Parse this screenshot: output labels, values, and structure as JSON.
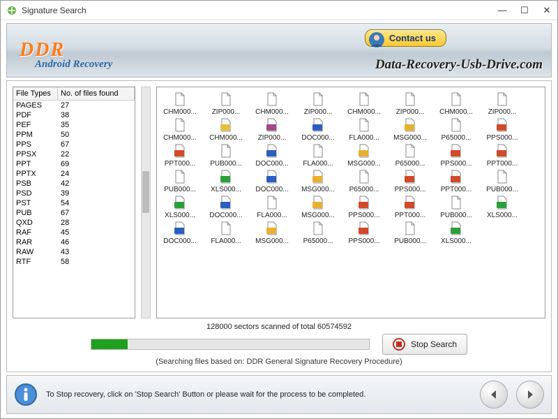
{
  "window": {
    "title": "Signature Search"
  },
  "header": {
    "brand": "DDR",
    "subtitle": "Android Recovery",
    "contact_label": "Contact us",
    "watermark": "Data-Recovery-Usb-Drive.com"
  },
  "fileTypesTable": {
    "col1": "File Types",
    "col2": "No. of files found",
    "rows": [
      {
        "type": "PAGES",
        "count": 27
      },
      {
        "type": "PDF",
        "count": 38
      },
      {
        "type": "PEF",
        "count": 35
      },
      {
        "type": "PPM",
        "count": 50
      },
      {
        "type": "PPS",
        "count": 67
      },
      {
        "type": "PPSX",
        "count": 22
      },
      {
        "type": "PPT",
        "count": 69
      },
      {
        "type": "PPTX",
        "count": 24
      },
      {
        "type": "PSB",
        "count": 42
      },
      {
        "type": "PSD",
        "count": 39
      },
      {
        "type": "PST",
        "count": 54
      },
      {
        "type": "PUB",
        "count": 67
      },
      {
        "type": "QXD",
        "count": 28
      },
      {
        "type": "RAF",
        "count": 45
      },
      {
        "type": "RAR",
        "count": 46
      },
      {
        "type": "RAW",
        "count": 43
      },
      {
        "type": "RTF",
        "count": 58
      }
    ]
  },
  "files": [
    {
      "name": "CHM000...",
      "icon": "file"
    },
    {
      "name": "ZIP000...",
      "icon": "file"
    },
    {
      "name": "CHM000...",
      "icon": "file"
    },
    {
      "name": "ZIP000...",
      "icon": "file"
    },
    {
      "name": "CHM000...",
      "icon": "file"
    },
    {
      "name": "ZIP000...",
      "icon": "file"
    },
    {
      "name": "CHM000...",
      "icon": "file"
    },
    {
      "name": "ZIP000...",
      "icon": "file"
    },
    {
      "name": "CHM000...",
      "icon": "file"
    },
    {
      "name": "CHM000...",
      "icon": "chm"
    },
    {
      "name": "ZIP000...",
      "icon": "zip"
    },
    {
      "name": "DOC000...",
      "icon": "doc"
    },
    {
      "name": "FLA000...",
      "icon": "file"
    },
    {
      "name": "MSG000...",
      "icon": "msg"
    },
    {
      "name": "P65000...",
      "icon": "file"
    },
    {
      "name": "PPS000...",
      "icon": "pps"
    },
    {
      "name": "PPT000...",
      "icon": "ppt"
    },
    {
      "name": "PUB000...",
      "icon": "file"
    },
    {
      "name": "DOC000...",
      "icon": "doc"
    },
    {
      "name": "FLA000...",
      "icon": "file"
    },
    {
      "name": "MSG000...",
      "icon": "msg"
    },
    {
      "name": "P65000...",
      "icon": "file"
    },
    {
      "name": "PPS000...",
      "icon": "pps"
    },
    {
      "name": "PPT000...",
      "icon": "ppt"
    },
    {
      "name": "PUB000...",
      "icon": "file"
    },
    {
      "name": "XLS000...",
      "icon": "xls"
    },
    {
      "name": "DOC000...",
      "icon": "doc"
    },
    {
      "name": "MSG000...",
      "icon": "msg"
    },
    {
      "name": "P65000...",
      "icon": "file"
    },
    {
      "name": "PPS000...",
      "icon": "pps"
    },
    {
      "name": "PPT000...",
      "icon": "ppt"
    },
    {
      "name": "PUB000...",
      "icon": "file"
    },
    {
      "name": "XLS000...",
      "icon": "xls"
    },
    {
      "name": "DOC000...",
      "icon": "doc"
    },
    {
      "name": "FLA000...",
      "icon": "file"
    },
    {
      "name": "MSG000...",
      "icon": "msg"
    },
    {
      "name": "PPS000...",
      "icon": "pps"
    },
    {
      "name": "PPT000...",
      "icon": "ppt"
    },
    {
      "name": "PUB000...",
      "icon": "file"
    },
    {
      "name": "XLS000...",
      "icon": "xls"
    },
    {
      "name": "DOC000...",
      "icon": "doc"
    },
    {
      "name": "FLA000...",
      "icon": "file"
    },
    {
      "name": "MSG000...",
      "icon": "msg"
    },
    {
      "name": "P65000...",
      "icon": "file"
    },
    {
      "name": "PPS000...",
      "icon": "pps"
    },
    {
      "name": "PUB000...",
      "icon": "file"
    },
    {
      "name": "XLS000...",
      "icon": "xls"
    }
  ],
  "progress": {
    "status": "128000 sectors scanned of total 60574592",
    "note": "(Searching files based on:  DDR General Signature Recovery Procedure)",
    "stop_label": "Stop Search",
    "percent": 13
  },
  "footer": {
    "hint": "To Stop recovery, click on 'Stop Search' Button or please wait for the process to be completed."
  },
  "icons": {
    "file": "#c0c8d0",
    "doc": "#2a5fbf",
    "msg": "#e8b030",
    "ppt": "#d04a2a",
    "pps": "#d04a2a",
    "xls": "#2a9f3a",
    "zip": "#a04a8a",
    "chm": "#e8c040"
  }
}
